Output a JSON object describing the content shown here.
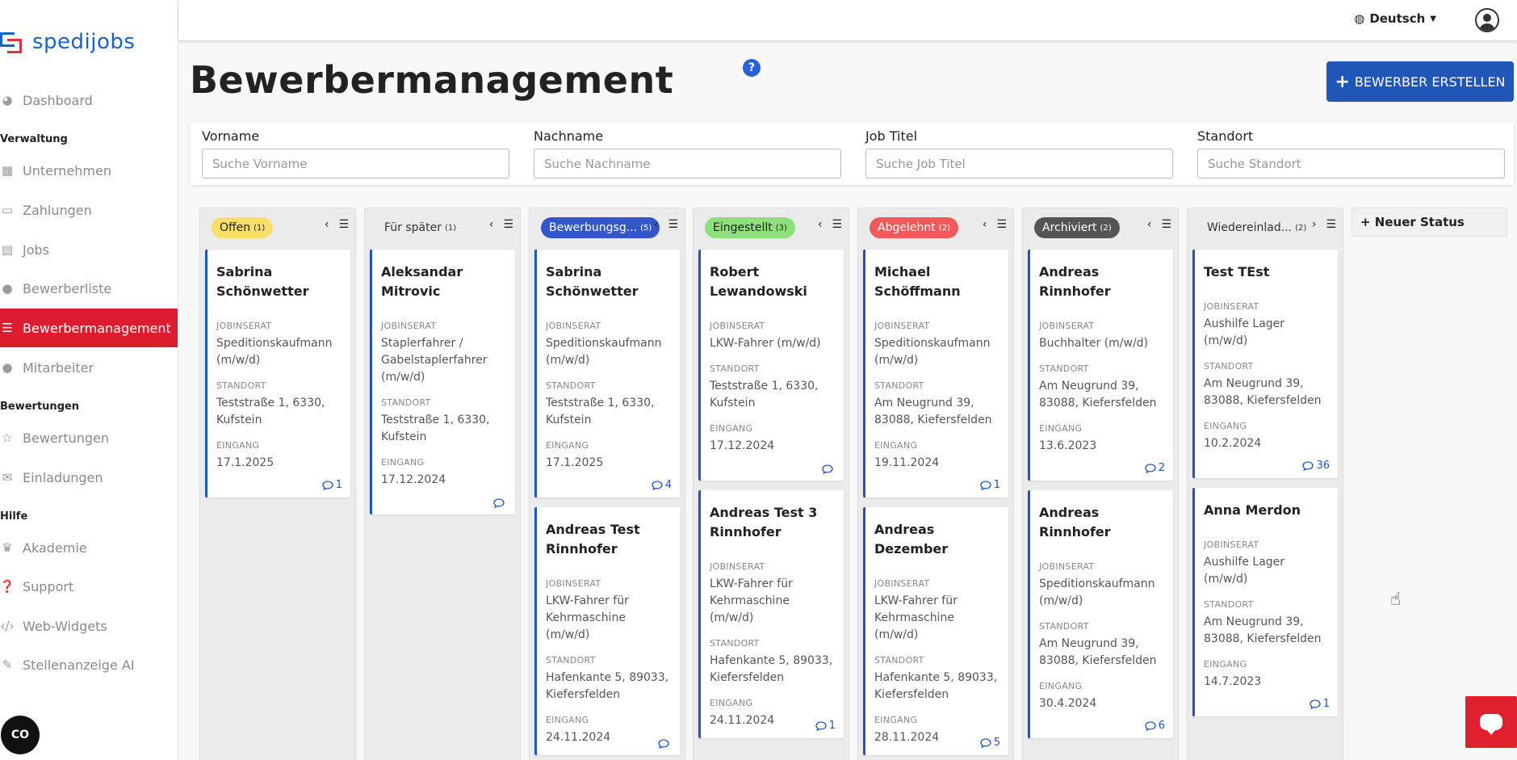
{
  "brand": {
    "name": "spedijobs"
  },
  "sidebar": {
    "items": [
      {
        "label": "Dashboard",
        "icon": "palette-icon"
      },
      {
        "label": "Unternehmen",
        "icon": "building-icon"
      },
      {
        "label": "Zahlungen",
        "icon": "credit-card-icon"
      },
      {
        "label": "Jobs",
        "icon": "briefcase-icon"
      },
      {
        "label": "Bewerberliste",
        "icon": "user-list-icon"
      },
      {
        "label": "Bewerbermanagement",
        "icon": "list-icon",
        "active": true
      },
      {
        "label": "Mitarbeiter",
        "icon": "users-icon"
      },
      {
        "label": "Bewertungen",
        "icon": "star-icon"
      },
      {
        "label": "Einladungen",
        "icon": "envelope-icon"
      },
      {
        "label": "Akademie",
        "icon": "graduation-icon"
      },
      {
        "label": "Support",
        "icon": "question-icon"
      },
      {
        "label": "Web-Widgets",
        "icon": "code-icon"
      },
      {
        "label": "Stellenanzeige AI",
        "icon": "magic-wand-icon"
      }
    ],
    "sections": [
      "Verwaltung",
      "Bewertungen",
      "Hilfe"
    ],
    "bottom_badge": "CO"
  },
  "topbar": {
    "language": "Deutsch"
  },
  "header": {
    "title": "Bewerbermanagement",
    "create_button": "BEWERBER ERSTELLEN",
    "create_plus": "+",
    "help": "?"
  },
  "filters": [
    {
      "label": "Vorname",
      "placeholder": "Suche Vorname"
    },
    {
      "label": "Nachname",
      "placeholder": "Suche Nachname"
    },
    {
      "label": "Job Titel",
      "placeholder": "Suche Job Titel"
    },
    {
      "label": "Standort",
      "placeholder": "Suche Standort"
    }
  ],
  "labels": {
    "job": "JOBINSERAT",
    "location": "STANDORT",
    "received": "EINGANG"
  },
  "new_status": "+ Neuer Status",
  "columns": [
    {
      "name": "Offen",
      "count": "(1)",
      "bg": "#f7df6a",
      "fg": "#222",
      "arrow": "‹",
      "cards": [
        {
          "first": "Sabrina",
          "last": "Schönwetter",
          "job": "Speditionskaufmann (m/w/d)",
          "loc": "Teststraße 1, 6330, Kufstein",
          "date": "17.1.2025",
          "comments": "1"
        }
      ]
    },
    {
      "name": "Für später",
      "count": "(1)",
      "bg": "transparent",
      "fg": "#333",
      "arrow": "‹",
      "cards": [
        {
          "first": "Aleksandar",
          "last": "Mitrovic",
          "job": "Staplerfahrer / Gabelstaplerfahrer (m/w/d)",
          "loc": "Teststraße 1, 6330, Kufstein",
          "date": "17.12.2024",
          "comments": ""
        }
      ]
    },
    {
      "name": "Bewerbungsg...",
      "count": "(5)",
      "bg": "#3357c9",
      "fg": "#fff",
      "arrow": "‹",
      "cards": [
        {
          "first": "Sabrina",
          "last": "Schönwetter",
          "job": "Speditionskaufmann (m/w/d)",
          "loc": "Teststraße 1, 6330, Kufstein",
          "date": "17.1.2025",
          "comments": "4"
        },
        {
          "first": "Andreas Test",
          "last": "Rinnhofer",
          "job": "LKW-Fahrer für Kehrmaschine (m/w/d)",
          "loc": "Hafenkante 5, 89033, Kiefersfelden",
          "date": "24.11.2024",
          "comments": ""
        }
      ]
    },
    {
      "name": "Eingestellt",
      "count": "(3)",
      "bg": "#8ee07a",
      "fg": "#222",
      "arrow": "‹",
      "cards": [
        {
          "first": "Robert",
          "last": "Lewandowski",
          "job": "LKW-Fahrer (m/w/d)",
          "loc": "Teststraße 1, 6330, Kufstein",
          "date": "17.12.2024",
          "comments": ""
        },
        {
          "first": "Andreas Test 3",
          "last": "Rinnhofer",
          "job": "LKW-Fahrer für Kehrmaschine (m/w/d)",
          "loc": "Hafenkante 5, 89033, Kiefersfelden",
          "date": "24.11.2024",
          "comments": "1"
        }
      ]
    },
    {
      "name": "Abgelehnt",
      "count": "(2)",
      "bg": "#f05a5a",
      "fg": "#fff",
      "arrow": "‹",
      "cards": [
        {
          "first": "Michael",
          "last": "Schöffmann",
          "job": "Speditionskaufmann (m/w/d)",
          "loc": "Am Neugrund 39, 83088, Kiefersfelden",
          "date": "19.11.2024",
          "comments": "1"
        },
        {
          "first": "Andreas",
          "last": "Dezember",
          "job": "LKW-Fahrer für Kehrmaschine (m/w/d)",
          "loc": "Hafenkante 5, 89033, Kiefersfelden",
          "date": "28.11.2024",
          "comments": "5"
        }
      ]
    },
    {
      "name": "Archiviert",
      "count": "(2)",
      "bg": "#555555",
      "fg": "#fff",
      "arrow": "‹",
      "cards": [
        {
          "first": "Andreas",
          "last": "Rinnhofer",
          "job": "Buchhalter (m/w/d)",
          "loc": "Am Neugrund 39, 83088, Kiefersfelden",
          "date": "13.6.2023",
          "comments": "2"
        },
        {
          "first": "Andreas",
          "last": "Rinnhofer",
          "job": "Speditionskaufmann (m/w/d)",
          "loc": "Am Neugrund 39, 83088, Kiefersfelden",
          "date": "30.4.2024",
          "comments": "6"
        }
      ]
    },
    {
      "name": "Wiedereinlad...",
      "count": "(2)",
      "bg": "transparent",
      "fg": "#333",
      "arrow": "›",
      "cards": [
        {
          "first": "Test TEst",
          "last": "",
          "job": "Aushilfe Lager (m/w/d)",
          "loc": "Am Neugrund 39, 83088, Kiefersfelden",
          "date": "10.2.2024",
          "comments": "36"
        },
        {
          "first": "Anna Merdon",
          "last": "",
          "job": "Aushilfe Lager (m/w/d)",
          "loc": "Am Neugrund 39, 83088, Kiefersfelden",
          "date": "14.7.2023",
          "comments": "1"
        }
      ]
    }
  ]
}
